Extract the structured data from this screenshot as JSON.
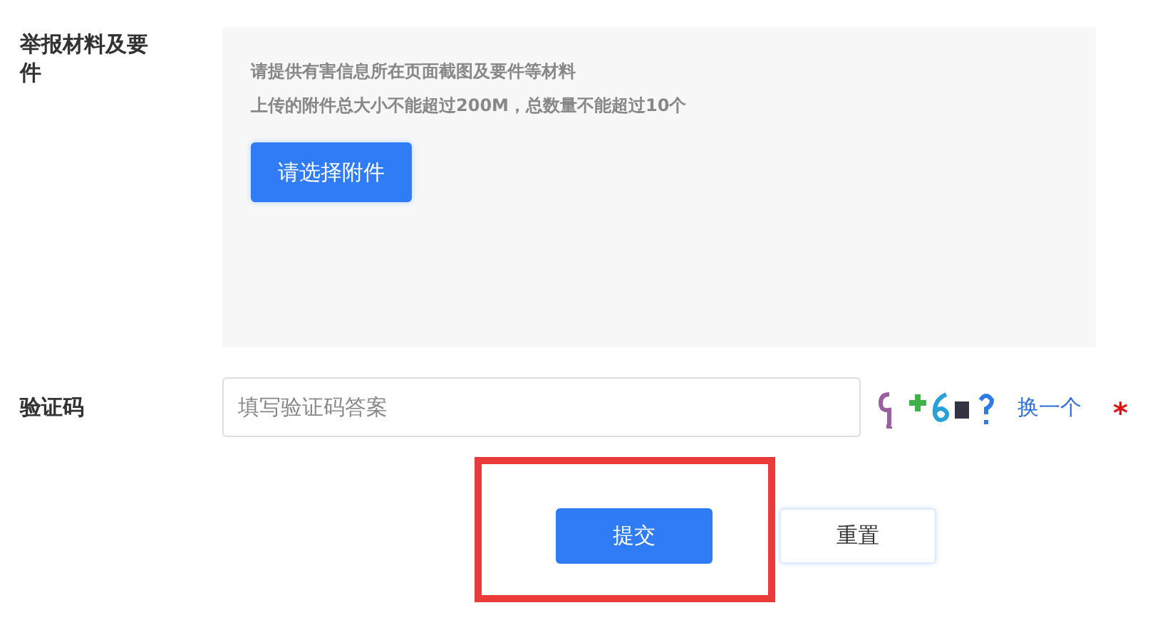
{
  "attachments": {
    "label": "举报材料及要件",
    "hints": [
      "请提供有害信息所在页面截图及要件等材料",
      "上传的附件总大小不能超过200M，总数量不能超过10个"
    ],
    "button": "请选择附件"
  },
  "captcha": {
    "label": "验证码",
    "placeholder": "填写验证码答案",
    "refresh": "换一个",
    "required_mark": "*"
  },
  "actions": {
    "submit": "提交",
    "reset": "重置",
    "submit_highlighted": true
  }
}
